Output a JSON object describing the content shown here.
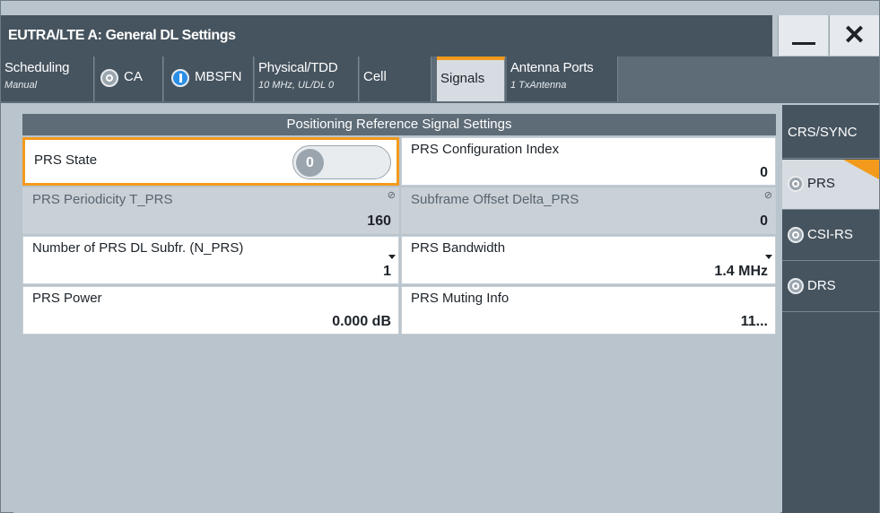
{
  "window": {
    "title": "EUTRA/LTE A: General DL Settings",
    "minimize_icon": "minimize-icon",
    "close_icon": "close-icon",
    "close_glyph": "✕"
  },
  "tabs": [
    {
      "label": "Scheduling",
      "sub": "Manual"
    },
    {
      "label": "CA",
      "led": "off"
    },
    {
      "label": "MBSFN",
      "led": "on"
    },
    {
      "label": "Physical/TDD",
      "sub": "10 MHz, UL/DL 0"
    },
    {
      "label": "Cell"
    },
    {
      "label": "Signals",
      "active": true
    },
    {
      "label": "Antenna Ports",
      "sub": "1 TxAntenna"
    }
  ],
  "panel": {
    "header": "Positioning Reference Signal Settings",
    "prs_state": {
      "label": "PRS State",
      "value": "0"
    },
    "prs_config_index": {
      "label": "PRS Configuration Index",
      "value": "0"
    },
    "prs_periodicity": {
      "label": "PRS Periodicity T_PRS",
      "value": "160"
    },
    "subframe_offset": {
      "label": "Subframe Offset Delta_PRS",
      "value": "0"
    },
    "num_prs_dl_subfr": {
      "label": "Number of PRS DL Subfr. (N_PRS)",
      "value": "1"
    },
    "prs_bandwidth": {
      "label": "PRS Bandwidth",
      "value": "1.4 MHz"
    },
    "prs_power": {
      "label": "PRS Power",
      "value": "0.000 dB"
    },
    "prs_muting_info": {
      "label": "PRS Muting Info",
      "value": "11..."
    }
  },
  "sidemenu": [
    {
      "label": "CRS/SYNC"
    },
    {
      "label": "PRS",
      "active": true
    },
    {
      "label": "CSI-RS"
    },
    {
      "label": "DRS"
    }
  ],
  "colors": {
    "accent": "#f39a1c",
    "led_on": "#2b8ee6",
    "title_bg": "#46545f",
    "content_bg": "#b9c4cc"
  }
}
